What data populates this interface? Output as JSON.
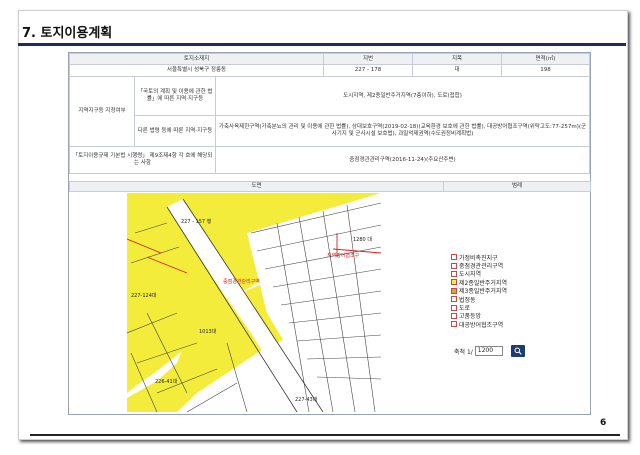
{
  "page": {
    "title": "7. 토지이용계획",
    "page_number": "6"
  },
  "info_table": {
    "headers": {
      "location": "토지소재지",
      "lot_no": "지번",
      "category": "지목",
      "area": "면적(㎡)"
    },
    "values": {
      "location": "서울특별시 성북구 정릉동",
      "lot_no": "227 - 178",
      "category": "대",
      "area": "198"
    },
    "zone_label": "지역지구등 지정여부",
    "national_law_label": "「국토의 계획 및 이용에 관한 법률」에 따른 지역·지구등",
    "national_law_value": "도시지역, 제2종일반주거지역(7층이하), 도로(접합)",
    "other_law_label": "다른 법령 등에 따른 지역·지구등",
    "other_law_value": "가축사육제한구역(가축분뇨의 관리 및 이용에 관한 법률), 상대보호구역(2019-02-18)(교육환경 보호에 관한 법률), 대공방어협조구역(위탁고도:77-257m)(군사기지 및 군사시설 보호법), 과밀억제권역(수도권정비계획법)",
    "enforcement_label": "「토지이용규제 기본법 시행령」 제9조제4항 각 호에 해당되는 사항",
    "enforcement_value": "중점경관관리구역(2016-11-24)(주요산주변)"
  },
  "map_section": {
    "map_header": "도면",
    "legend_header": "범례",
    "map_labels": [
      "227-157 행",
      "1280 대",
      "227-124대",
      "1013대",
      "226-41대",
      "227-43대",
      "중점경관관리구역",
      "지역방어협조구"
    ],
    "legend_items": [
      {
        "label": "가정비촉진지구",
        "color": "#ffffff"
      },
      {
        "label": "중점경관관리구역",
        "color": "#ffffff"
      },
      {
        "label": "도시지역",
        "color": "#ffffff"
      },
      {
        "label": "제2종일반주거지역",
        "color": "#f3ec3a"
      },
      {
        "label": "제3종일반주거지역",
        "color": "#d6a832"
      },
      {
        "label": "법정동",
        "color": "#ffffff"
      },
      {
        "label": "도로",
        "color": "#ffffff"
      },
      {
        "label": "고품등앙",
        "color": "#ffffff"
      },
      {
        "label": "대공방어협조구역",
        "color": "#ffffff"
      }
    ],
    "scale_label": "축척 1/",
    "scale_value": "1200"
  },
  "colors": {
    "accent": "#1d2c5a",
    "zone_yellow": "#f3ec3a",
    "boundary_red": "#d62020",
    "button": "#1f3b73"
  }
}
